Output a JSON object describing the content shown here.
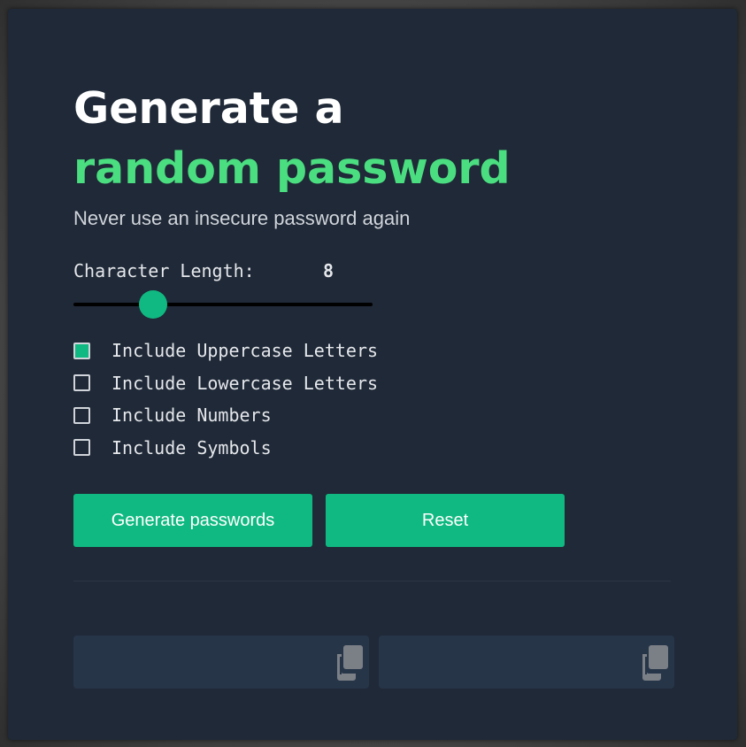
{
  "header": {
    "title_line1": "Generate a",
    "title_line2": "random password",
    "subtitle": "Never use an insecure password again"
  },
  "length": {
    "label": "Character Length:",
    "value": "8",
    "slider_fraction": 0.265
  },
  "options": [
    {
      "label": "Include Uppercase Letters",
      "checked": true
    },
    {
      "label": "Include Lowercase Letters",
      "checked": false
    },
    {
      "label": "Include Numbers",
      "checked": false
    },
    {
      "label": "Include Symbols",
      "checked": false
    }
  ],
  "buttons": {
    "generate_label": "Generate passwords",
    "reset_label": "Reset"
  },
  "outputs": [
    {
      "value": "",
      "icon": "copy-icon"
    },
    {
      "value": "",
      "icon": "copy-icon"
    }
  ],
  "colors": {
    "background": "#1f2937",
    "accent": "#10b981",
    "accent_text": "#4ade80",
    "output_bg": "#273549"
  }
}
